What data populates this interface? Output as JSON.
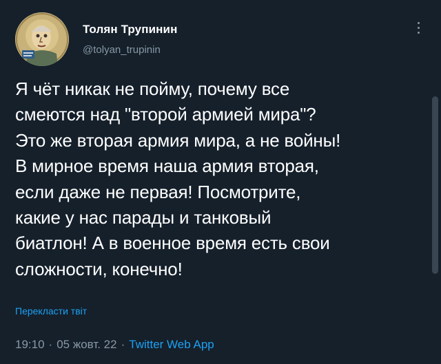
{
  "author": {
    "display_name": "Толян Трупинин",
    "handle": "@tolyan_trupinin",
    "avatar_icon": "cartoon-portrait-avatar"
  },
  "tweet": {
    "text": "Я чёт никак не пойму, почему все\nсмеются над \"второй армией мира\"?\nЭто же вторая армия мира, а не войны!\nВ мирное время наша армия вторая,\nесли даже не первая! Посмотрите,\nкакие у нас парады и танковый\nбиатлон! А в военное время есть свои\nсложности, конечно!",
    "translate_label": "Перекласти твіт"
  },
  "meta": {
    "time": "19:10",
    "date": "05 жовт. 22",
    "separator": "·",
    "source": "Twitter Web App"
  },
  "icons": {
    "more": "more-vertical-icon"
  },
  "colors": {
    "background": "#15202b",
    "text": "#ffffff",
    "secondary": "#8899a6",
    "accent": "#1da1f2"
  }
}
